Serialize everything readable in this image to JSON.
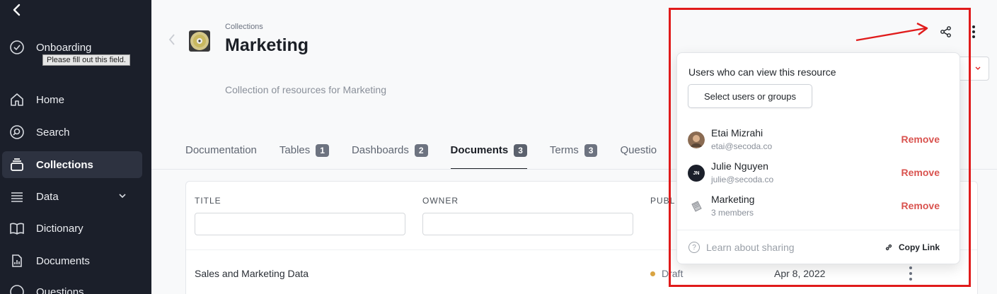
{
  "sidebar": {
    "tooltip": "Please fill out this field.",
    "items": [
      {
        "label": "Onboarding",
        "icon": "check-circle-icon"
      },
      {
        "label": "Home",
        "icon": "home-icon"
      },
      {
        "label": "Search",
        "icon": "search-icon"
      },
      {
        "label": "Collections",
        "icon": "collection-icon",
        "active": true
      },
      {
        "label": "Data",
        "icon": "list-icon"
      },
      {
        "label": "Dictionary",
        "icon": "book-icon"
      },
      {
        "label": "Documents",
        "icon": "document-icon"
      },
      {
        "label": "Questions",
        "icon": "question-icon"
      }
    ]
  },
  "header": {
    "breadcrumb": "Collections",
    "title": "Marketing",
    "description": "Collection of resources for Marketing"
  },
  "tabs": [
    {
      "label": "Documentation",
      "count": ""
    },
    {
      "label": "Tables",
      "count": "1"
    },
    {
      "label": "Dashboards",
      "count": "2"
    },
    {
      "label": "Documents",
      "count": "3",
      "active": true
    },
    {
      "label": "Terms",
      "count": "3"
    },
    {
      "label": "Questio",
      "count": ""
    }
  ],
  "table": {
    "columns": [
      "TITLE",
      "OWNER",
      "PUBL"
    ],
    "rows": [
      {
        "title": "Sales and Marketing Data",
        "status": "Draft",
        "date": "Apr 8, 2022"
      }
    ]
  },
  "share_popover": {
    "heading": "Users who can view this resource",
    "select_label": "Select users or groups",
    "remove_label": "Remove",
    "users": [
      {
        "name": "Etai Mizrahi",
        "detail": "etai@secoda.co"
      },
      {
        "name": "Julie Nguyen",
        "detail": "julie@secoda.co",
        "initials": "JN"
      },
      {
        "name": "Marketing",
        "detail": "3 members"
      }
    ],
    "learn_label": "Learn about sharing",
    "copy_label": "Copy Link"
  },
  "colors": {
    "sidebar_bg": "#1b1f2a",
    "remove": "#d9534f",
    "annotation": "#e01b1b",
    "draft_dot": "#d9a441"
  }
}
